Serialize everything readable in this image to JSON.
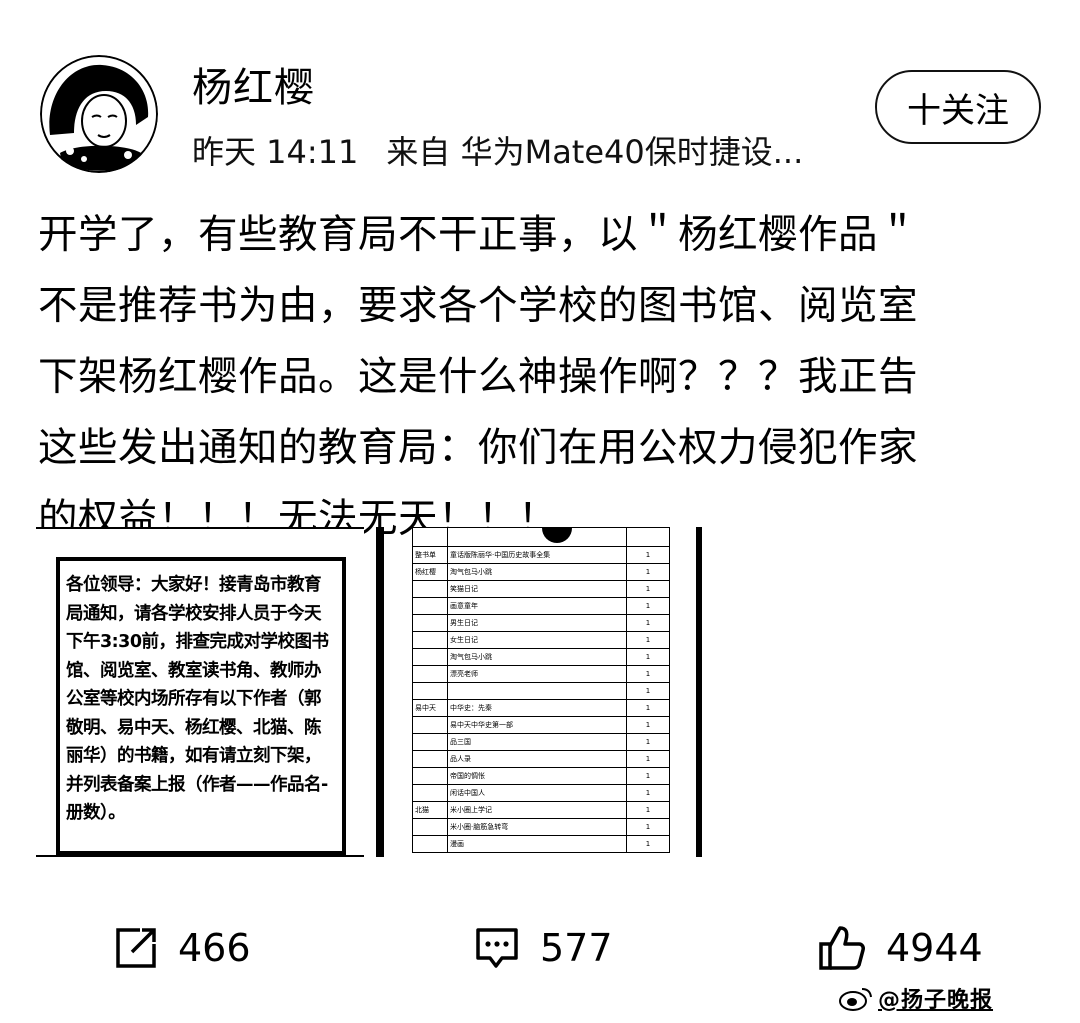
{
  "author": {
    "name": "杨红樱",
    "time": "昨天 14:11",
    "source": "来自 华为Mate40保时捷设..."
  },
  "follow_button": {
    "label": "十关注"
  },
  "post": {
    "lines": [
      "开学了，有些教育局不干正事，以＂杨红樱作品＂",
      "不是推荐书为由，要求各个学校的图书馆、阅览室",
      "下架杨红樱作品。这是什么神操作啊？？？我正告",
      "这些发出通知的教育局：你们在用公权力侵犯作家",
      "的权益！！！无法无天！！！"
    ]
  },
  "image_notice": {
    "text": "各位领导：大家好！接青岛市教育局通知，请各学校安排人员于今天下午3:30前，排查完成对学校图书馆、阅览室、教室读书角、教师办公室等校内场所存有以下作者（郭敬明、易中天、杨红樱、北猫、陈丽华）的书籍，如有请立刻下架，并列表备案上报（作者——作品名-册数）。"
  },
  "image_table": {
    "rows": [
      {
        "cat": "整书单",
        "title": "童话版陈丽华·中国历史故事全集",
        "num": "1"
      },
      {
        "cat": "杨红樱",
        "title": "淘气包马小跳",
        "num": "1"
      },
      {
        "cat": "",
        "title": "笑猫日记",
        "num": "1"
      },
      {
        "cat": "",
        "title": "画意童年",
        "num": "1"
      },
      {
        "cat": "",
        "title": "男生日记",
        "num": "1"
      },
      {
        "cat": "",
        "title": "女生日记",
        "num": "1"
      },
      {
        "cat": "",
        "title": "淘气包马小跳",
        "num": "1"
      },
      {
        "cat": "",
        "title": "漂亮老师",
        "num": "1"
      },
      {
        "cat": "",
        "title": "",
        "num": "1"
      },
      {
        "cat": "易中天",
        "title": "中华史：先秦",
        "num": "1"
      },
      {
        "cat": "",
        "title": "易中天中华史第一部",
        "num": "1"
      },
      {
        "cat": "",
        "title": "品三国",
        "num": "1"
      },
      {
        "cat": "",
        "title": "品人录",
        "num": "1"
      },
      {
        "cat": "",
        "title": "帝国的惆怅",
        "num": "1"
      },
      {
        "cat": "",
        "title": "闲话中国人",
        "num": "1"
      },
      {
        "cat": "北猫",
        "title": "米小圈上学记",
        "num": "1"
      },
      {
        "cat": "",
        "title": "米小圈·脑筋急转弯",
        "num": "1"
      },
      {
        "cat": "",
        "title": "漫画",
        "num": "1"
      }
    ]
  },
  "actions": {
    "repost": {
      "icon": "share-icon",
      "count": "466"
    },
    "comment": {
      "icon": "comment-icon",
      "count": "577"
    },
    "like": {
      "icon": "thumbs-up-icon",
      "count": "4944"
    }
  },
  "watermark": {
    "text": "@扬子晚报"
  }
}
